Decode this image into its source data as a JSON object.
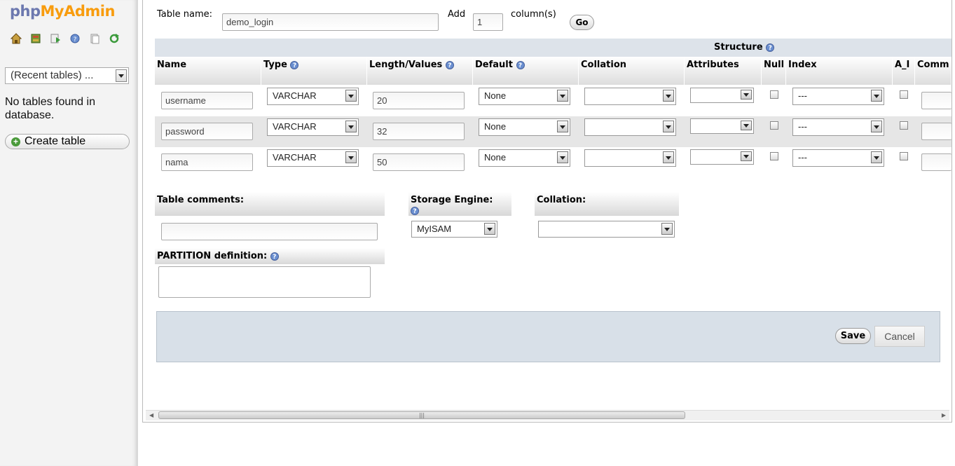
{
  "sidebar": {
    "logo": {
      "php": "php",
      "my": "My",
      "admin": "Admin"
    },
    "nav_icons": [
      "home-icon",
      "database-icon",
      "sql-icon",
      "help-icon",
      "documentation-icon",
      "reload-icon"
    ],
    "recent_tables": "(Recent tables) ...",
    "no_tables": "No tables found in database.",
    "create_table": "Create table"
  },
  "form": {
    "table_name_label": "Table name:",
    "table_name_value": "demo_login",
    "add_label": "Add",
    "add_value": "1",
    "columns_label": "column(s)",
    "go_label": "Go",
    "structure_label": "Structure",
    "headers": [
      "Name",
      "Type",
      "Length/Values",
      "Default",
      "Collation",
      "Attributes",
      "Null",
      "Index",
      "A_I",
      "Comm"
    ],
    "rows": [
      {
        "name": "username",
        "type": "VARCHAR",
        "length": "20",
        "default": "None",
        "collation": "",
        "attributes": "",
        "index": "---"
      },
      {
        "name": "password",
        "type": "VARCHAR",
        "length": "32",
        "default": "None",
        "collation": "",
        "attributes": "",
        "index": "---"
      },
      {
        "name": "nama",
        "type": "VARCHAR",
        "length": "50",
        "default": "None",
        "collation": "",
        "attributes": "",
        "index": "---"
      }
    ],
    "table_comments_label": "Table comments:",
    "storage_engine_label": "Storage Engine:",
    "storage_engine_value": "MyISAM",
    "collation_label": "Collation:",
    "partition_label": "PARTITION definition:",
    "save_label": "Save",
    "cancel_label": "Cancel"
  },
  "colors": {
    "accent": "#f89c0e",
    "php": "#6c78af",
    "panel": "#d8e0e8"
  }
}
